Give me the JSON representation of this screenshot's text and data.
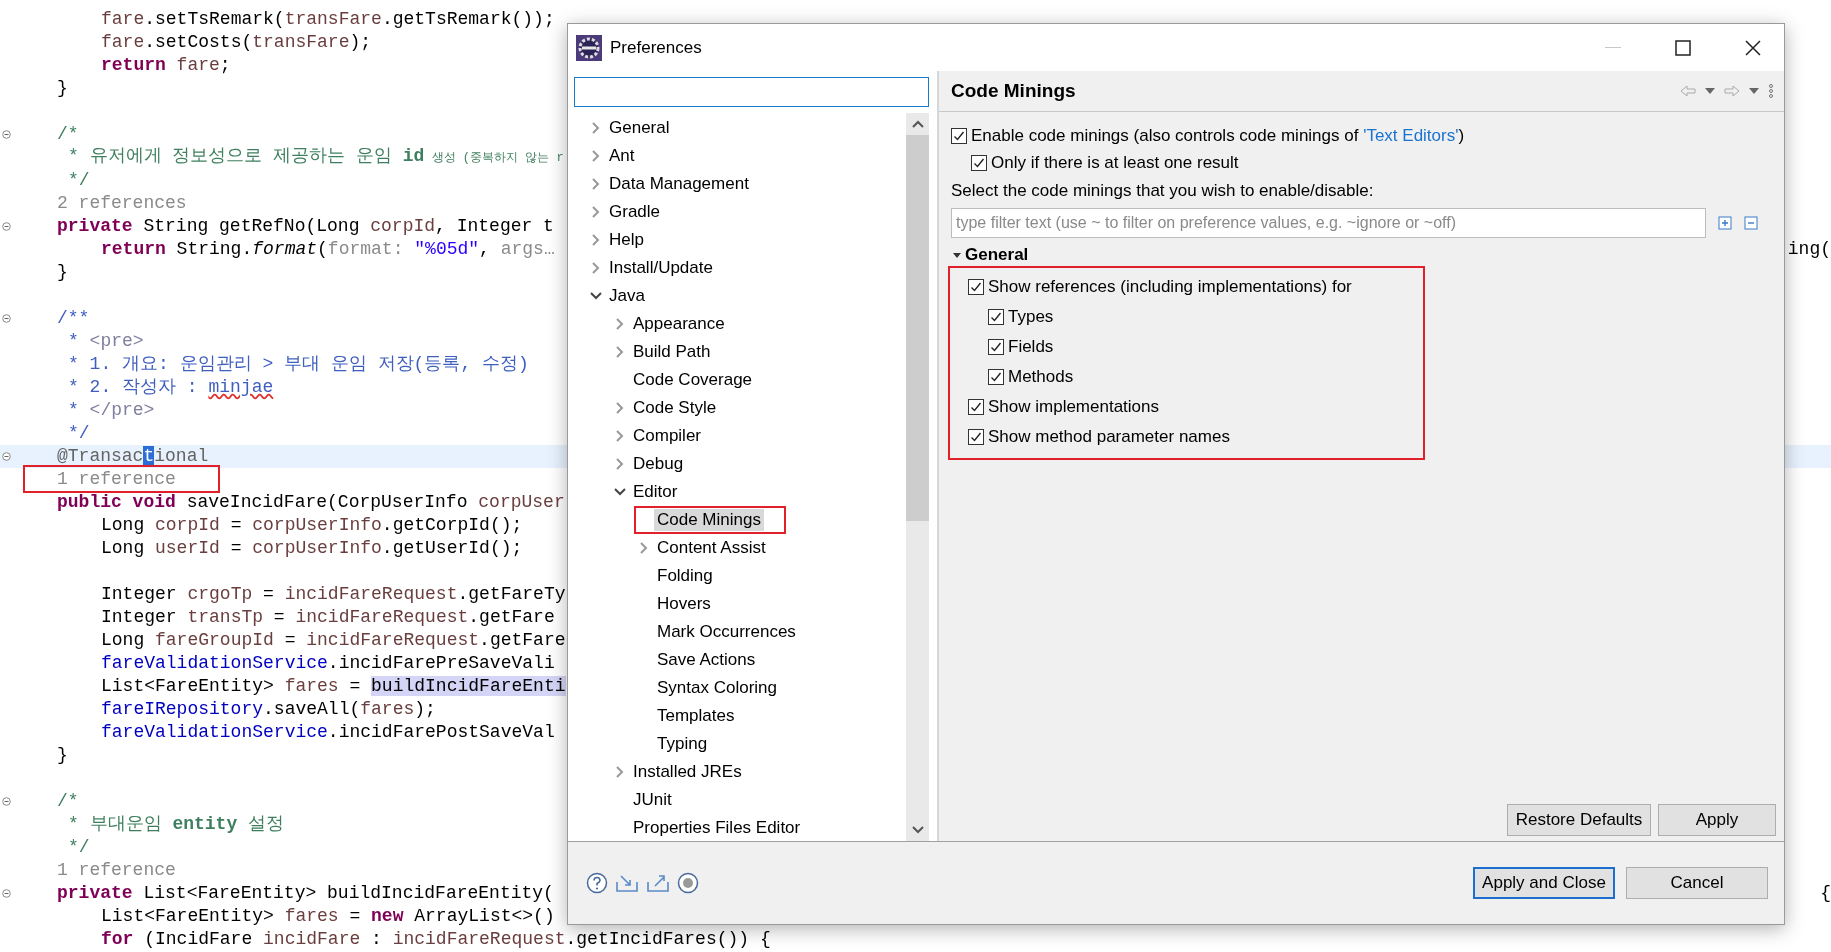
{
  "editor": {
    "lines": [
      {
        "kind": "body",
        "segments": [
          {
            "kind": "local",
            "text": "fare"
          },
          {
            "kind": "plain",
            "text": ".setTsRemark("
          },
          {
            "kind": "local",
            "text": "transFare"
          },
          {
            "kind": "plain",
            "text": ".getTsRemark());"
          }
        ]
      },
      {
        "kind": "body",
        "segments": [
          {
            "kind": "local",
            "text": "fare"
          },
          {
            "kind": "plain",
            "text": ".setCosts("
          },
          {
            "kind": "local",
            "text": "transFare"
          },
          {
            "kind": "plain",
            "text": ");"
          }
        ]
      },
      {
        "kind": "body",
        "segments": [
          {
            "kind": "keyword",
            "text": "return"
          },
          {
            "kind": "local",
            "text": " fare"
          },
          {
            "kind": "plain",
            "text": ";"
          }
        ]
      },
      {
        "kind": "member",
        "segments": [
          {
            "kind": "plain",
            "text": "}"
          }
        ]
      },
      {
        "kind": "blank"
      },
      {
        "kind": "member",
        "fold_marker": true,
        "segments": [
          {
            "kind": "comment",
            "text": "/*"
          }
        ]
      },
      {
        "kind": "doc",
        "segments": [
          {
            "kind": "comment",
            "text": "* 유저에게 정보성으로 제공하는 운임 "
          },
          {
            "kind": "comment-bold",
            "text": "id"
          },
          {
            "kind": "comment-condensed",
            "text": " 생성 (중복하지 않는 r"
          }
        ]
      },
      {
        "kind": "doc",
        "segments": [
          {
            "kind": "comment",
            "text": "*/"
          }
        ]
      },
      {
        "kind": "member",
        "segments": [
          {
            "kind": "hint",
            "text": "2 references"
          }
        ]
      },
      {
        "kind": "member",
        "fold_marker": true,
        "segments": [
          {
            "kind": "keyword",
            "text": "private"
          },
          {
            "kind": "plain",
            "text": " String getRefNo(Long "
          },
          {
            "kind": "local",
            "text": "corpId"
          },
          {
            "kind": "plain",
            "text": ", Integer t"
          }
        ]
      },
      {
        "kind": "body",
        "tail": "ing(",
        "segments": [
          {
            "kind": "keyword",
            "text": "return"
          },
          {
            "kind": "plain",
            "text": " String."
          },
          {
            "kind": "static-call",
            "text": "format"
          },
          {
            "kind": "plain",
            "text": "("
          },
          {
            "kind": "hint",
            "text": "format: "
          },
          {
            "kind": "string",
            "text": "\"%05d\""
          },
          {
            "kind": "plain",
            "text": ", "
          },
          {
            "kind": "hint",
            "text": "args…"
          }
        ]
      },
      {
        "kind": "member",
        "segments": [
          {
            "kind": "plain",
            "text": "}"
          }
        ]
      },
      {
        "kind": "blank"
      },
      {
        "kind": "member",
        "fold_marker": true,
        "segments": [
          {
            "kind": "doc",
            "text": "/**"
          }
        ]
      },
      {
        "kind": "doc",
        "segments": [
          {
            "kind": "doc",
            "text": "* "
          },
          {
            "kind": "tag",
            "text": "<pre>"
          }
        ]
      },
      {
        "kind": "doc",
        "segments": [
          {
            "kind": "doc",
            "text": "* 1. 개요: 운임관리 > 부대 운임 저장(등록, 수정)"
          }
        ]
      },
      {
        "kind": "doc",
        "segments": [
          {
            "kind": "doc",
            "text": "* 2. 작성자 : "
          },
          {
            "kind": "misspelled",
            "text": "minjae"
          }
        ]
      },
      {
        "kind": "doc",
        "segments": [
          {
            "kind": "doc",
            "text": "* "
          },
          {
            "kind": "tag",
            "text": "</pre>"
          }
        ]
      },
      {
        "kind": "doc",
        "segments": [
          {
            "kind": "doc",
            "text": "*/"
          }
        ]
      },
      {
        "kind": "member",
        "fold_marker": true,
        "current": true,
        "segments": [
          {
            "kind": "annotation",
            "text": "@Transac"
          },
          {
            "kind": "caret",
            "text": "t"
          },
          {
            "kind": "annotation",
            "text": "ional"
          }
        ]
      },
      {
        "kind": "member",
        "boxed": true,
        "segments": [
          {
            "kind": "hint",
            "text": "1 reference"
          }
        ]
      },
      {
        "kind": "member",
        "segments": [
          {
            "kind": "keyword",
            "text": "public"
          },
          {
            "kind": "keyword",
            "text": " void"
          },
          {
            "kind": "plain",
            "text": " saveIncidFare(CorpUserInfo "
          },
          {
            "kind": "local",
            "text": "corpUser"
          }
        ]
      },
      {
        "kind": "body",
        "segments": [
          {
            "kind": "plain",
            "text": "Long "
          },
          {
            "kind": "local",
            "text": "corpId"
          },
          {
            "kind": "plain",
            "text": " = "
          },
          {
            "kind": "local",
            "text": "corpUserInfo"
          },
          {
            "kind": "plain",
            "text": ".getCorpId();"
          }
        ]
      },
      {
        "kind": "body",
        "segments": [
          {
            "kind": "plain",
            "text": "Long "
          },
          {
            "kind": "local",
            "text": "userId"
          },
          {
            "kind": "plain",
            "text": " = "
          },
          {
            "kind": "local",
            "text": "corpUserInfo"
          },
          {
            "kind": "plain",
            "text": ".getUserId();"
          }
        ]
      },
      {
        "kind": "blank"
      },
      {
        "kind": "body",
        "segments": [
          {
            "kind": "plain",
            "text": "Integer "
          },
          {
            "kind": "local",
            "text": "crgoTp"
          },
          {
            "kind": "plain",
            "text": " = "
          },
          {
            "kind": "local",
            "text": "incidFareRequest"
          },
          {
            "kind": "plain",
            "text": ".getFareTy"
          }
        ]
      },
      {
        "kind": "body",
        "segments": [
          {
            "kind": "plain",
            "text": "Integer "
          },
          {
            "kind": "local",
            "text": "transTp"
          },
          {
            "kind": "plain",
            "text": " = "
          },
          {
            "kind": "local",
            "text": "incidFareRequest"
          },
          {
            "kind": "plain",
            "text": ".getFare"
          }
        ]
      },
      {
        "kind": "body",
        "segments": [
          {
            "kind": "plain",
            "text": "Long "
          },
          {
            "kind": "local",
            "text": "fareGroupId"
          },
          {
            "kind": "plain",
            "text": " = "
          },
          {
            "kind": "local",
            "text": "incidFareRequest"
          },
          {
            "kind": "plain",
            "text": ".getFare"
          }
        ]
      },
      {
        "kind": "body",
        "segments": [
          {
            "kind": "field",
            "text": "fareValidationService"
          },
          {
            "kind": "plain",
            "text": ".incidFarePreSaveVali"
          }
        ]
      },
      {
        "kind": "body",
        "segments": [
          {
            "kind": "plain",
            "text": "List<FareEntity> "
          },
          {
            "kind": "local",
            "text": "fares"
          },
          {
            "kind": "plain",
            "text": " = "
          },
          {
            "kind": "occurrence",
            "text": "buildIncidFareEnti"
          }
        ]
      },
      {
        "kind": "body",
        "segments": [
          {
            "kind": "field",
            "text": "fareIRepository"
          },
          {
            "kind": "plain",
            "text": ".saveAll("
          },
          {
            "kind": "local",
            "text": "fares"
          },
          {
            "kind": "plain",
            "text": ");"
          }
        ]
      },
      {
        "kind": "body",
        "segments": [
          {
            "kind": "field",
            "text": "fareValidationService"
          },
          {
            "kind": "plain",
            "text": ".incidFarePostSaveVal"
          }
        ]
      },
      {
        "kind": "member",
        "segments": [
          {
            "kind": "plain",
            "text": "}"
          }
        ]
      },
      {
        "kind": "blank"
      },
      {
        "kind": "member",
        "fold_marker": true,
        "segments": [
          {
            "kind": "comment",
            "text": "/*"
          }
        ]
      },
      {
        "kind": "doc",
        "segments": [
          {
            "kind": "comment",
            "text": "* 부대운임 "
          },
          {
            "kind": "comment-bold",
            "text": "entity"
          },
          {
            "kind": "comment",
            "text": " 설정"
          }
        ]
      },
      {
        "kind": "doc",
        "segments": [
          {
            "kind": "comment",
            "text": "*/"
          }
        ]
      },
      {
        "kind": "member",
        "segments": [
          {
            "kind": "hint",
            "text": "1 reference"
          }
        ]
      },
      {
        "kind": "member",
        "fold_marker": true,
        "tail": "{",
        "segments": [
          {
            "kind": "keyword",
            "text": "private"
          },
          {
            "kind": "plain",
            "text": " List<FareEntity> buildIncidFareEntity("
          }
        ]
      },
      {
        "kind": "body",
        "segments": [
          {
            "kind": "plain",
            "text": "List<FareEntity> "
          },
          {
            "kind": "local",
            "text": "fares"
          },
          {
            "kind": "plain",
            "text": " = "
          },
          {
            "kind": "keyword",
            "text": "new"
          },
          {
            "kind": "plain",
            "text": " ArrayList<>()"
          }
        ]
      },
      {
        "kind": "body",
        "segments": [
          {
            "kind": "keyword",
            "text": "for"
          },
          {
            "kind": "plain",
            "text": " (IncidFare "
          },
          {
            "kind": "local",
            "text": "incidFare"
          },
          {
            "kind": "plain",
            "text": " : "
          },
          {
            "kind": "local",
            "text": "incidFareRequest"
          },
          {
            "kind": "plain",
            "text": ".getIncidFares()) {"
          }
        ]
      }
    ]
  },
  "dialog": {
    "title": "Preferences",
    "tree": [
      {
        "label": "General",
        "kind": "collapsed",
        "selected": false
      },
      {
        "label": "Ant",
        "kind": "collapsed",
        "selected": false
      },
      {
        "label": "Data Management",
        "kind": "collapsed",
        "selected": false
      },
      {
        "label": "Gradle",
        "kind": "collapsed",
        "selected": false
      },
      {
        "label": "Help",
        "kind": "collapsed",
        "selected": false
      },
      {
        "label": "Install/Update",
        "kind": "collapsed",
        "selected": false
      },
      {
        "label": "Java",
        "kind": "expanded",
        "selected": false,
        "children": [
          {
            "label": "Appearance",
            "kind": "collapsed",
            "selected": false
          },
          {
            "label": "Build Path",
            "kind": "collapsed",
            "selected": false
          },
          {
            "label": "Code Coverage",
            "kind": "leaf",
            "selected": false
          },
          {
            "label": "Code Style",
            "kind": "collapsed",
            "selected": false
          },
          {
            "label": "Compiler",
            "kind": "collapsed",
            "selected": false
          },
          {
            "label": "Debug",
            "kind": "collapsed",
            "selected": false
          },
          {
            "label": "Editor",
            "kind": "expanded",
            "selected": false,
            "children": [
              {
                "label": "Code Minings",
                "kind": "leaf",
                "selected": true,
                "boxed": true
              },
              {
                "label": "Content Assist",
                "kind": "collapsed",
                "selected": false
              },
              {
                "label": "Folding",
                "kind": "leaf",
                "selected": false
              },
              {
                "label": "Hovers",
                "kind": "leaf",
                "selected": false
              },
              {
                "label": "Mark Occurrences",
                "kind": "leaf",
                "selected": false
              },
              {
                "label": "Save Actions",
                "kind": "leaf",
                "selected": false
              },
              {
                "label": "Syntax Coloring",
                "kind": "leaf",
                "selected": false
              },
              {
                "label": "Templates",
                "kind": "leaf",
                "selected": false
              },
              {
                "label": "Typing",
                "kind": "leaf",
                "selected": false
              }
            ]
          },
          {
            "label": "Installed JREs",
            "kind": "collapsed",
            "selected": false
          },
          {
            "label": "JUnit",
            "kind": "leaf",
            "selected": false
          },
          {
            "label": "Properties Files Editor",
            "kind": "leaf",
            "selected": false
          }
        ]
      }
    ],
    "page": {
      "title": "Code Minings",
      "options": [
        {
          "label": "Enable code minings (also controls code minings of ",
          "link": "'Text Editors'",
          "suffix": ")",
          "checked": true,
          "children": [
            {
              "label": "Only if there is at least one result",
              "checked": true
            }
          ]
        }
      ],
      "prompt": "Select the code minings that you wish to enable/disable:",
      "filter": {
        "placeholder": "type filter text (use ~ to filter on preference values, e.g. ~ignore or ~off)"
      },
      "sections": [
        {
          "title": "General",
          "expanded": true,
          "boxed": true,
          "items": [
            {
              "label": "Show references (including implementations) for",
              "checked": true,
              "children": [
                {
                  "label": "Types",
                  "checked": true
                },
                {
                  "label": "Fields",
                  "checked": true
                },
                {
                  "label": "Methods",
                  "checked": true
                }
              ]
            },
            {
              "label": "Show implementations",
              "checked": true
            },
            {
              "label": "Show method parameter names",
              "checked": true
            }
          ]
        }
      ],
      "buttons": [
        "Restore Defaults",
        "Apply"
      ]
    },
    "buttons": [
      {
        "label": "Apply and Close",
        "default": true
      },
      {
        "label": "Cancel",
        "default": false
      }
    ]
  }
}
